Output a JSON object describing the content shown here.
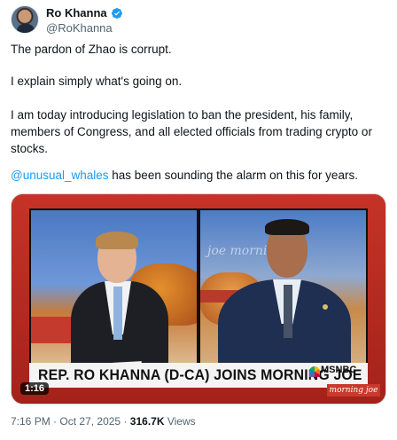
{
  "author": {
    "display_name": "Ro Khanna",
    "handle": "@RoKhanna",
    "verified": true
  },
  "tweet": {
    "p1": "The pardon of Zhao is corrupt.",
    "p2": "I explain simply what's going on.",
    "p3": "I am today introducing legislation to ban the president, his family, members of Congress, and all elected officials from trading crypto or stocks.",
    "p4_mention": "@unusual_whales",
    "p4_rest": " has been sounding the alarm on this for years."
  },
  "video": {
    "duration": "1:16",
    "chyron": "REP. RO KHANNA (D-CA) JOINS MORNING JOE",
    "network": "MSNBC",
    "show_tag": "morning joe",
    "watermark": "joe morning joe"
  },
  "meta": {
    "time": "7:16 PM",
    "separator": "·",
    "date": "Oct 27, 2025",
    "views_count": "316.7K",
    "views_label": "Views"
  },
  "colors": {
    "accent": "#1d9bf0",
    "text": "#0f1419",
    "muted": "#536471",
    "video_frame": "#b52a1f"
  }
}
